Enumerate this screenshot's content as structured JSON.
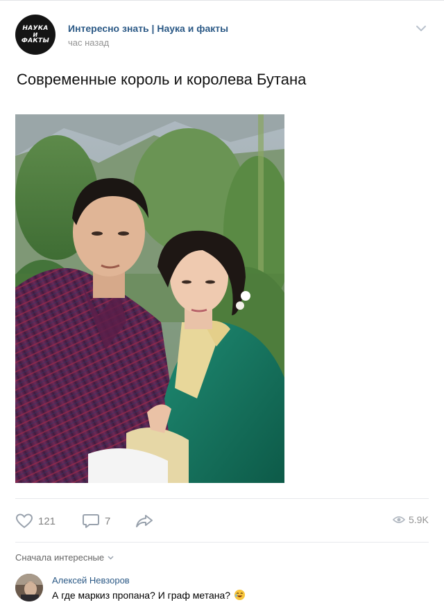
{
  "header": {
    "avatar_lines": [
      "НАУКА",
      "И",
      "ФАКТЫ"
    ],
    "group_name": "Интересно знать | Наука и факты",
    "time": "час назад",
    "menu_icon": "chevron-down-icon"
  },
  "post": {
    "title": "Современные король и королева Бутана",
    "photo_icon": "photo-king-queen"
  },
  "actions": {
    "likes": "121",
    "comments": "7",
    "views": "5.9K",
    "icons": [
      "heart-icon",
      "comment-icon",
      "share-icon",
      "eye-icon"
    ]
  },
  "comments": {
    "sort_label": "Сначала интересные",
    "items": [
      {
        "author": "Алексей Невзоров",
        "text": "А где маркиз пропана? И граф метана?",
        "emoji": "laughing-emoji-icon"
      }
    ]
  },
  "colors": {
    "link": "#2a5885",
    "muted": "#939393",
    "icon": "#99a2ad"
  }
}
